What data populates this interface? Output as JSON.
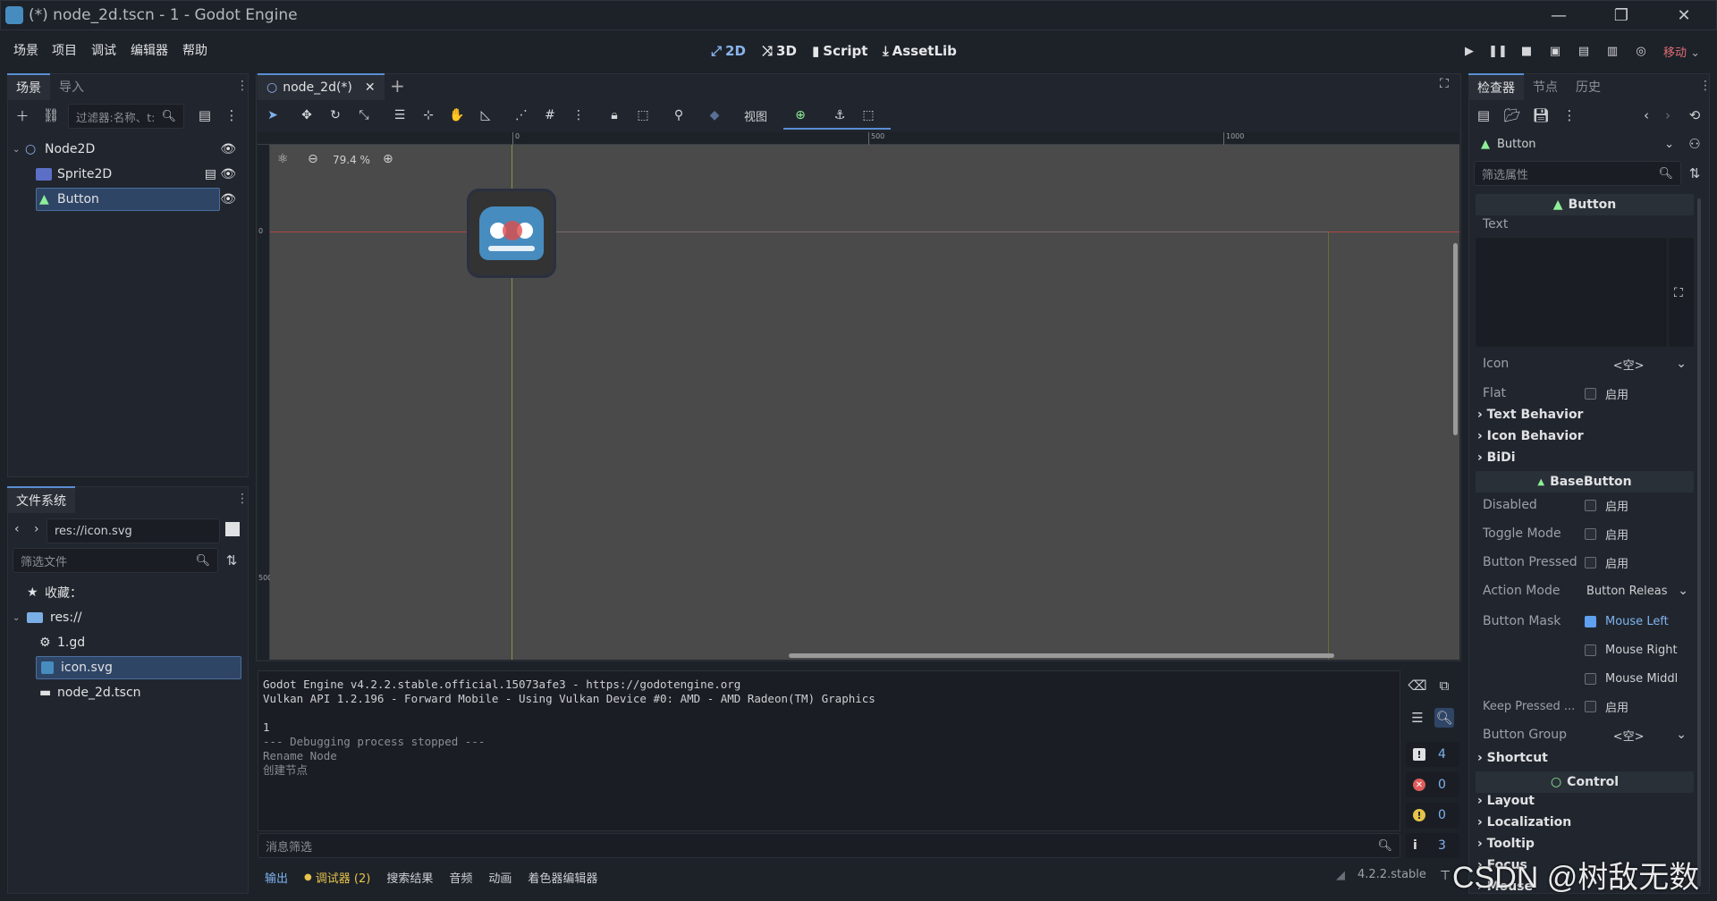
{
  "window": {
    "title": "(*) node_2d.tscn - 1 - Godot Engine",
    "minimize": "—",
    "maximize": "❐",
    "close": "✕"
  },
  "menu": [
    "场景",
    "项目",
    "调试",
    "编辑器",
    "帮助"
  ],
  "workspaces": {
    "w2d": "2D",
    "w3d": "3D",
    "script": "Script",
    "assetlib": "AssetLib"
  },
  "renderer": "移动",
  "scene_dock": {
    "tabs": [
      "场景",
      "导入"
    ],
    "filter_placeholder": "过滤器:名称、t:",
    "nodes": [
      {
        "name": "Node2D"
      },
      {
        "name": "Sprite2D"
      },
      {
        "name": "Button"
      }
    ]
  },
  "filesystem": {
    "tab": "文件系统",
    "path": "res://icon.svg",
    "filter_placeholder": "筛选文件",
    "favorites": "收藏：",
    "root": "res://",
    "files": [
      "1.gd",
      "icon.svg",
      "node_2d.tscn"
    ]
  },
  "editor": {
    "tab": "node_2d(*)",
    "add_tab": "+",
    "view_menu": "视图",
    "zoom": "79.4 %",
    "ruler_marks": [
      "0",
      "500",
      "1000"
    ],
    "vruler_marks": [
      "0",
      "500"
    ]
  },
  "console": {
    "lines": [
      "Godot Engine v4.2.2.stable.official.15073afe3 - https://godotengine.org",
      "Vulkan API 1.2.196 - Forward Mobile - Using Vulkan Device #0: AMD - AMD Radeon(TM) Graphics",
      "",
      "1"
    ],
    "dim_lines": [
      "--- Debugging process stopped ---",
      "Rename Node",
      "创建节点"
    ],
    "filter_placeholder": "消息筛选",
    "counts": {
      "messages": "4",
      "errors": "0",
      "warnings": "0",
      "info": "3"
    }
  },
  "bottom_tabs": [
    "输出",
    "调试器 (2)",
    "搜索结果",
    "音频",
    "动画",
    "着色器编辑器"
  ],
  "version": "4.2.2.stable",
  "watermark": "CSDN @树敌无数",
  "inspector": {
    "tabs": [
      "检查器",
      "节点",
      "历史"
    ],
    "object": "Button",
    "filter_placeholder": "筛选属性",
    "sections": {
      "button": "Button",
      "basebutton": "BaseButton",
      "control": "Control"
    },
    "text_label": "Text",
    "icon_label": "Icon",
    "empty": "<空>",
    "flat_label": "Flat",
    "enable": "启用",
    "groups1": [
      "Text Behavior",
      "Icon Behavior",
      "BiDi"
    ],
    "disabled_label": "Disabled",
    "toggle_label": "Toggle Mode",
    "pressed_label": "Button Pressed",
    "action_label": "Action Mode",
    "action_value": "Button Releas",
    "mask_label": "Button Mask",
    "mask_left": "Mouse Left",
    "mask_right": "Mouse Right",
    "mask_middle": "Mouse Middl",
    "keep_label": "Keep Pressed ...",
    "group_label": "Button Group",
    "shortcut": "Shortcut",
    "groups2": [
      "Layout",
      "Localization",
      "Tooltip",
      "Focus",
      "Mouse"
    ]
  },
  "colors": {
    "accent": "#5a8ed3",
    "viewport_bg": "#4a4a4a",
    "panel": "#21262e",
    "bg": "#1d2229"
  }
}
